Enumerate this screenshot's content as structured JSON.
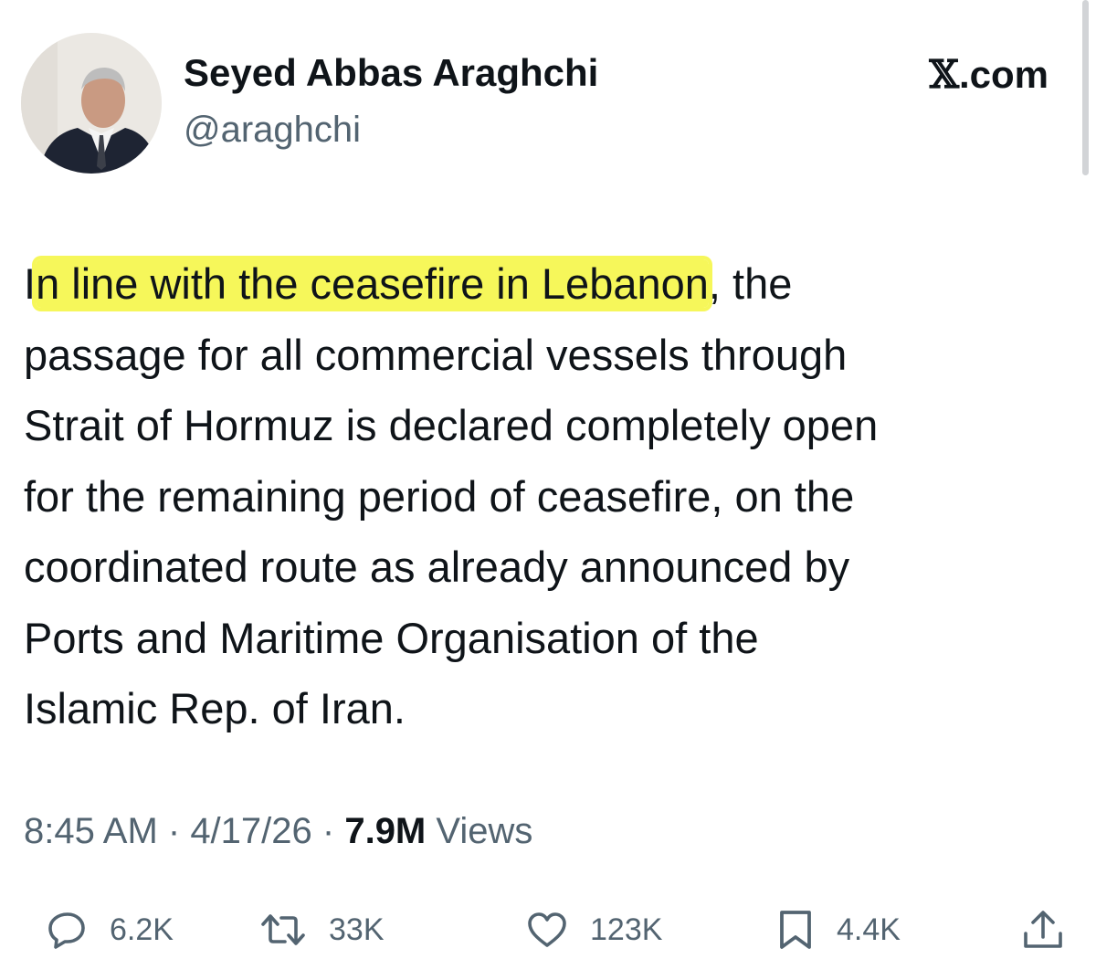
{
  "author": {
    "display_name": "Seyed Abbas Araghchi",
    "handle": "@araghchi"
  },
  "brand": {
    "x_glyph": "𝕏",
    "suffix": ".com"
  },
  "tweet": {
    "text_lead": "I",
    "text_highlight": "n line with the ceasefire in Lebanon",
    "text_rest": ", the\npassage for all commercial vessels through\nStrait of Hormuz is declared completely open\nfor the remaining period of ceasefire, on the\ncoordinated route as already announced by\nPorts and Maritime Organisation of the\nIslamic Rep. of Iran.",
    "highlight_color": "#f6f75a"
  },
  "meta": {
    "time": "8:45 AM",
    "sep1": " · ",
    "date": "4/17/26",
    "sep2": " · ",
    "views_count": "7.9M",
    "views_label": " Views"
  },
  "actions": {
    "replies": "6.2K",
    "reposts": "33K",
    "likes": "123K",
    "bookmarks": "4.4K"
  },
  "icons": {
    "reply": "reply-icon",
    "repost": "repost-icon",
    "like": "heart-icon",
    "bookmark": "bookmark-icon",
    "share": "share-icon"
  },
  "colors": {
    "text": "#0f1419",
    "secondary": "#536471"
  }
}
